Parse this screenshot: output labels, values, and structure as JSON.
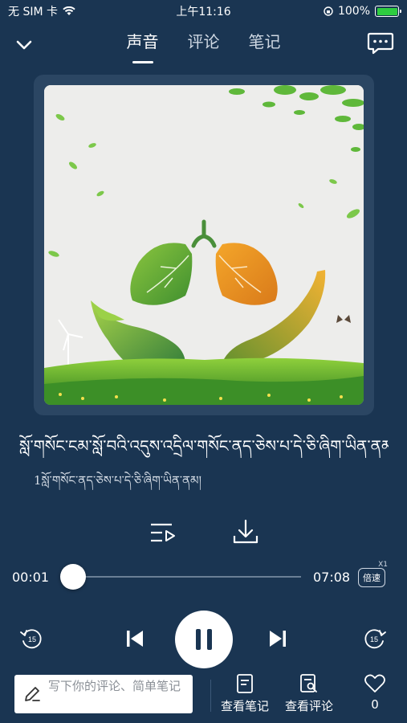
{
  "status_bar": {
    "carrier": "无 SIM 卡",
    "time": "上午11:16",
    "battery": "100%",
    "battery_color": "#2ecc40"
  },
  "header": {
    "tabs": [
      {
        "label": "声音",
        "active": true
      },
      {
        "label": "评论",
        "active": false
      },
      {
        "label": "笔记",
        "active": false
      }
    ],
    "back_icon": "chevron-down-icon",
    "chat_icon": "chat-bubble-icon"
  },
  "track": {
    "title": "སློ་གསོང་ངམ་སློ་བའི་འདུས་འདྲིལ་གསོང་ནད་ཅེས་པ་དེ་ཅི་ཞིག་ཡིན་ནམ།",
    "subtitle": "1སློ་གསོང་ནད་ཅེས་པ་དེ་ཅི་ཞིག་ཡིན་ནམ།"
  },
  "player": {
    "current_time": "00:01",
    "total_time": "07:08",
    "progress": 0.002,
    "speed_label": "倍速",
    "speed_multiplier": "X1",
    "rewind_seconds": "15",
    "forward_seconds": "15",
    "state": "playing"
  },
  "bottom_bar": {
    "comment_placeholder": "写下你的评论、简单笔记",
    "view_notes": "查看笔记",
    "view_comments": "查看评论",
    "like_count": "0"
  },
  "colors": {
    "background": "#1a3552",
    "cover_frame": "#2b4663",
    "accent": "#ffffff"
  }
}
